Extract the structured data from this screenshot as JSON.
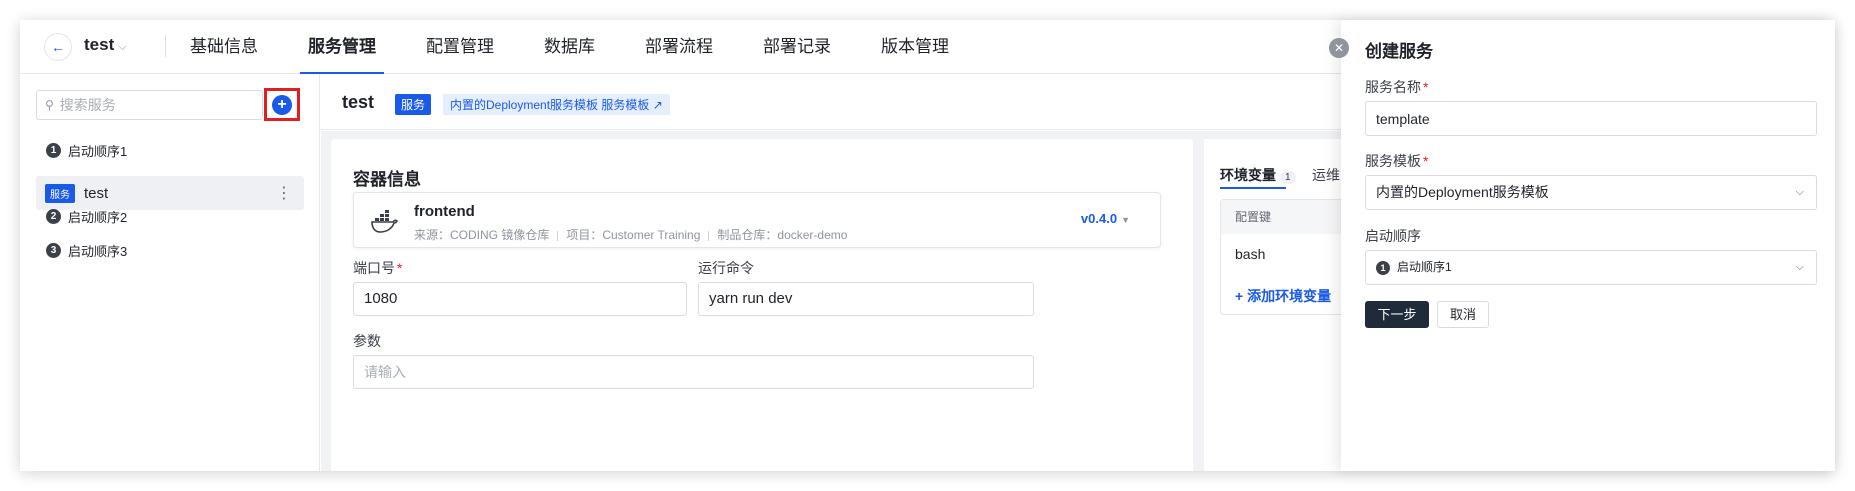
{
  "header": {
    "back_icon": "arrow-left-icon",
    "project_name": "test",
    "tabs": [
      {
        "label": "基础信息",
        "active": false
      },
      {
        "label": "服务管理",
        "active": true
      },
      {
        "label": "配置管理",
        "active": false
      },
      {
        "label": "数据库",
        "active": false
      },
      {
        "label": "部署流程",
        "active": false
      },
      {
        "label": "部署记录",
        "active": false
      },
      {
        "label": "版本管理",
        "active": false
      }
    ]
  },
  "sidebar": {
    "search_placeholder": "搜索服务",
    "add_icon": "plus-icon",
    "groups": [
      {
        "num": "1",
        "label": "启动顺序1"
      },
      {
        "num": "2",
        "label": "启动顺序2"
      },
      {
        "num": "3",
        "label": "启动顺序3"
      }
    ],
    "service": {
      "badge": "服务",
      "name": "test",
      "more": "⋮"
    }
  },
  "main": {
    "title": "test",
    "badge": "服务",
    "template_tag": "内置的Deployment服务模板 服务模板 ↗",
    "container": {
      "heading": "容器信息",
      "image_name": "frontend",
      "meta": [
        "来源：CODING 镜像仓库",
        "项目：Customer Training",
        "制品仓库：docker-demo"
      ],
      "version": "v0.4.0"
    },
    "port_label": "端口号",
    "port_value": "1080",
    "command_label": "运行命令",
    "command_value": "yarn run dev",
    "args_label": "参数",
    "args_placeholder": "请输入"
  },
  "env": {
    "tab_label": "环境变量",
    "tab_count": "1",
    "ops_tab_label": "运维",
    "column_key": "配置键",
    "row_key": "bash",
    "add_label": "+ 添加环境变量"
  },
  "drawer": {
    "title": "创建服务",
    "close_icon": "close-icon",
    "name_label": "服务名称",
    "name_value": "template",
    "template_label": "服务模板",
    "template_value": "内置的Deployment服务模板",
    "order_label": "启动顺序",
    "order_num": "1",
    "order_value": "启动顺序1",
    "next_button": "下一步",
    "cancel_button": "取消"
  },
  "colors": {
    "accent": "#1a5ae8",
    "highlight_border": "#e02020",
    "primary_button": "#1f2a3a"
  }
}
